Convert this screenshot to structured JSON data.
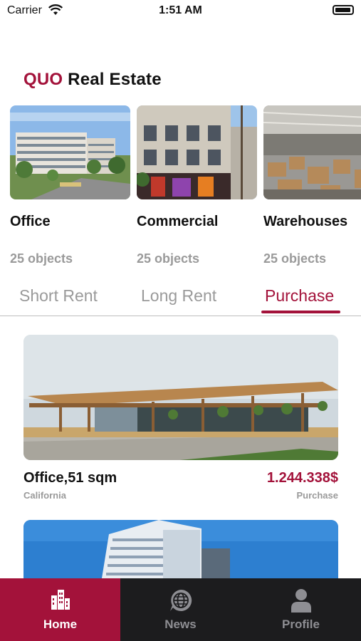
{
  "status_bar": {
    "carrier": "Carrier",
    "time": "1:51 AM"
  },
  "header": {
    "brand_accent": "QUO",
    "brand_rest": "Real Estate"
  },
  "categories": [
    {
      "name": "Office",
      "count": "25 objects"
    },
    {
      "name": "Commercial",
      "count": "25 objects"
    },
    {
      "name": "Warehouses",
      "count": "25 objects"
    }
  ],
  "tabs": [
    "Short Rent",
    "Long Rent",
    "Purchase"
  ],
  "active_tab": "Purchase",
  "listings": [
    {
      "title": "Office,51 sqm",
      "location": "California",
      "price": "1.244.338$",
      "type": "Purchase"
    }
  ],
  "bottom_nav": [
    {
      "label": "Home",
      "icon": "buildings-icon"
    },
    {
      "label": "News",
      "icon": "globe-icon"
    },
    {
      "label": "Profile",
      "icon": "person-icon"
    }
  ],
  "colors": {
    "accent": "#a3123a",
    "nav_bg": "#1c1c1e",
    "muted": "#9a9a9a"
  }
}
